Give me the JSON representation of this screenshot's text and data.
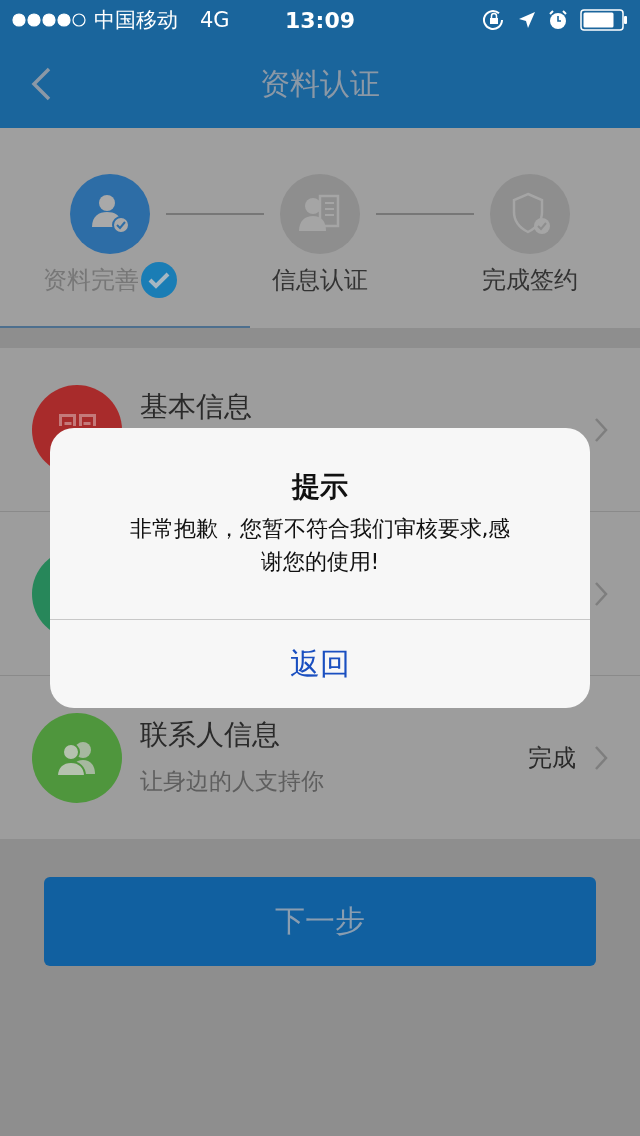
{
  "status_bar": {
    "carrier": "中国移动",
    "network": "4G",
    "time": "13:09"
  },
  "nav": {
    "title": "资料认证"
  },
  "steps": [
    {
      "label": "资料完善",
      "done": true
    },
    {
      "label": "信息认证",
      "done": false
    },
    {
      "label": "完成签约",
      "done": false
    }
  ],
  "rows": [
    {
      "kind": "basic",
      "title": "基本信息",
      "color": "#a82b2b"
    },
    {
      "kind": "hidden",
      "color": "#27875a"
    },
    {
      "kind": "contacts",
      "title": "联系人信息",
      "subtitle": "让身边的人支持你",
      "status": "完成",
      "color": "#4f963d"
    }
  ],
  "next_button": "下一步",
  "dialog": {
    "title": "提示",
    "message": "非常抱歉，您暂不符合我们审核要求,感谢您的使用!",
    "action": "返回"
  }
}
